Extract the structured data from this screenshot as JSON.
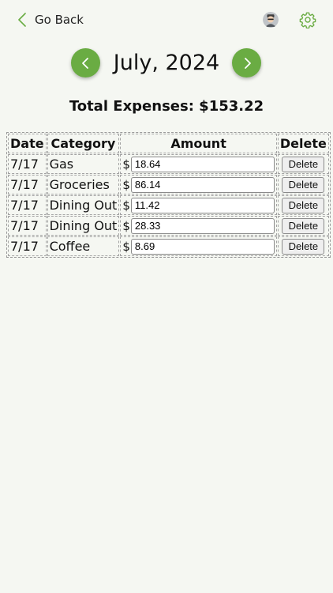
{
  "header": {
    "back_label": "Go Back",
    "icons": [
      "chevron-left-icon",
      "avatar-icon",
      "gear-icon"
    ]
  },
  "month_nav": {
    "title": "July, 2024",
    "prev_icon": "chevron-left-icon",
    "next_icon": "chevron-right-icon"
  },
  "summary": {
    "total_text": "Total Expenses: $153.22"
  },
  "table": {
    "headers": {
      "date": "Date",
      "category": "Category",
      "amount": "Amount",
      "delete": "Delete"
    },
    "currency_symbol": "$",
    "rows": [
      {
        "date": "7/17",
        "category": "Gas",
        "amount": "18.64",
        "delete_label": "Delete"
      },
      {
        "date": "7/17",
        "category": "Groceries",
        "amount": "86.14",
        "delete_label": "Delete"
      },
      {
        "date": "7/17",
        "category": "Dining Out",
        "amount": "11.42",
        "delete_label": "Delete"
      },
      {
        "date": "7/17",
        "category": "Dining Out",
        "amount": "28.33",
        "delete_label": "Delete"
      },
      {
        "date": "7/17",
        "category": "Coffee",
        "amount": "8.69",
        "delete_label": "Delete"
      }
    ]
  },
  "colors": {
    "accent": "#6aac43",
    "background": "#f5f7f2"
  }
}
